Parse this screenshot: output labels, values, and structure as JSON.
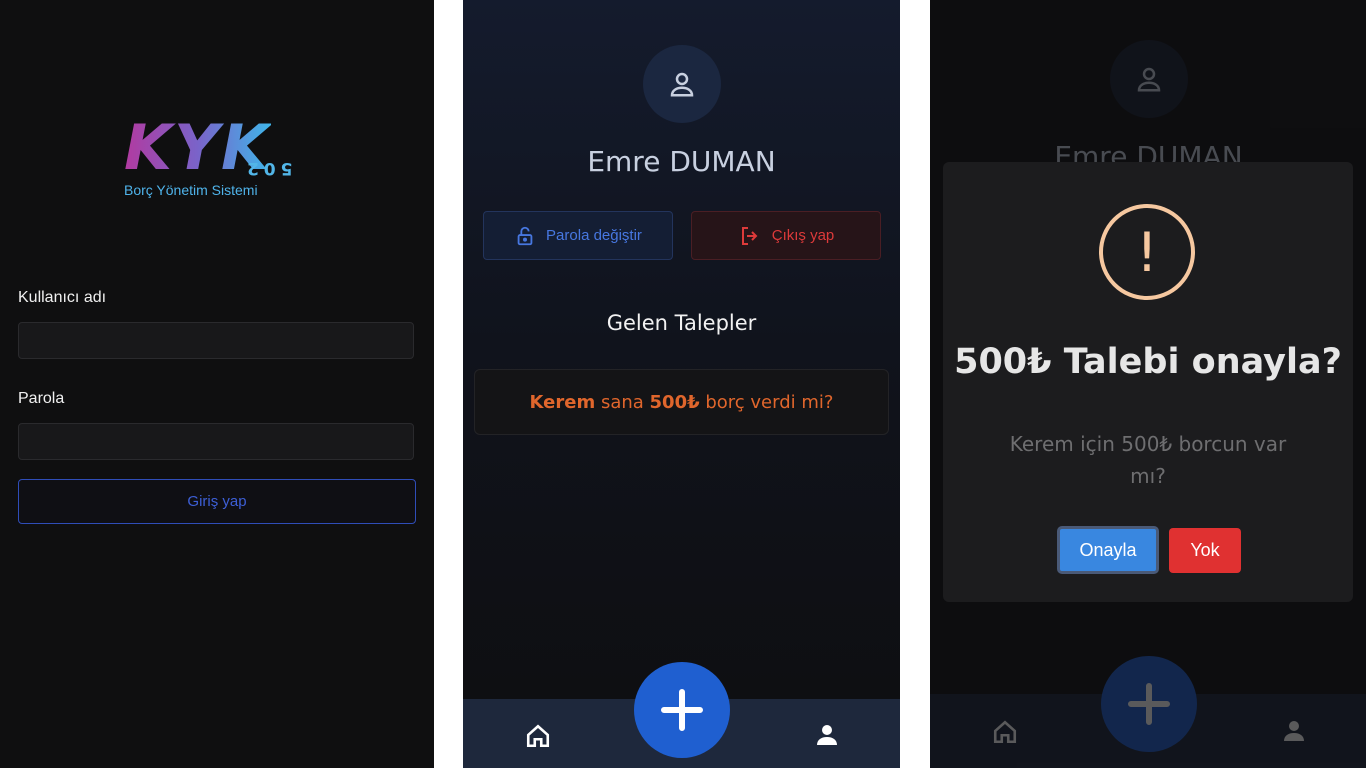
{
  "login": {
    "logo_text": "KYK",
    "logo_number": "502",
    "logo_subtitle": "Borç Yönetim Sistemi",
    "username_label": "Kullanıcı adı",
    "username_value": "",
    "password_label": "Parola",
    "password_value": "",
    "login_button": "Giriş yap"
  },
  "profile": {
    "user_name": "Emre DUMAN",
    "change_password_button": "Parola değiştir",
    "logout_button": "Çıkış yap",
    "requests_title": "Gelen Talepler",
    "request": {
      "from": "Kerem",
      "mid": " sana ",
      "amount": "500₺",
      "tail": " borç verdi mi?"
    }
  },
  "confirm_dialog": {
    "title": "500₺ Talebi onayla?",
    "text": "Kerem için 500₺ borcun var mı?",
    "confirm_button": "Onayla",
    "cancel_button": "Yok"
  },
  "nav": {
    "home_icon": "home-icon",
    "add_icon": "plus-icon",
    "profile_icon": "user-icon"
  },
  "colors": {
    "accent_blue": "#1f5fd0",
    "danger_red": "#e03131",
    "request_orange": "#e0662c",
    "warning": "#f6c8a0"
  }
}
